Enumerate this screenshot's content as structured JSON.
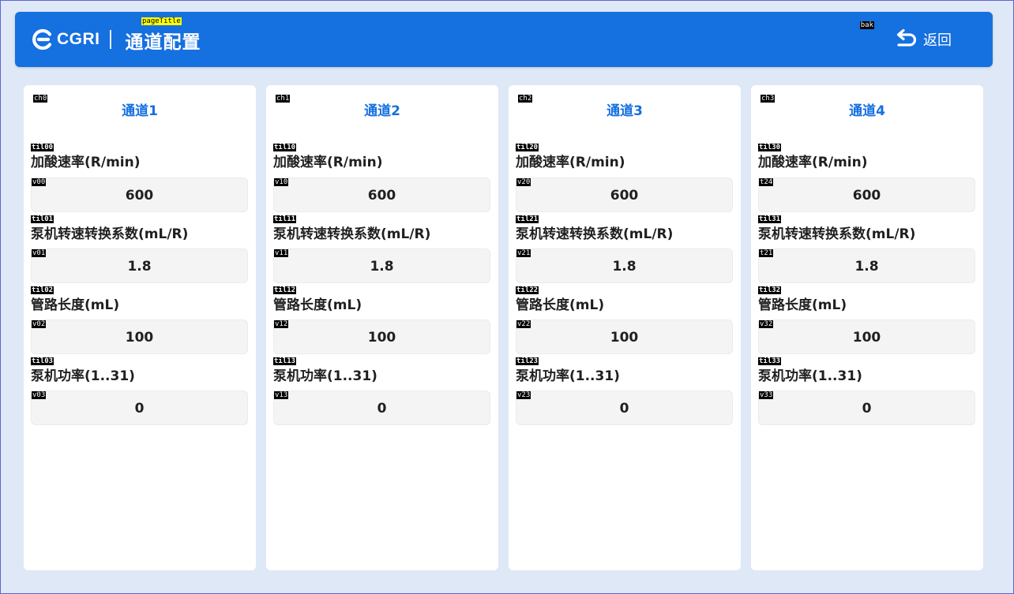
{
  "header": {
    "brand": "CGRI",
    "title": "通道配置",
    "title_tag": "pageTitle",
    "back_label": "返回",
    "back_tag": "bak"
  },
  "colors": {
    "header_bg": "#1570e0",
    "page_bg": "#dfe8f6",
    "channel_title": "#1570e0"
  },
  "icons": {
    "logo": "cgri-logo-icon",
    "back": "return-arrow-icon"
  },
  "channels": [
    {
      "title": "通道1",
      "tag": "ch0",
      "fields": [
        {
          "label": "加酸速率(R/min)",
          "label_tag": "til00",
          "value": "600",
          "value_tag": "v00"
        },
        {
          "label": "泵机转速转换系数(mL/R)",
          "label_tag": "til01",
          "value": "1.8",
          "value_tag": "v01"
        },
        {
          "label": "管路长度(mL)",
          "label_tag": "til02",
          "value": "100",
          "value_tag": "v02"
        },
        {
          "label": "泵机功率(1..31)",
          "label_tag": "til03",
          "value": "0",
          "value_tag": "v03"
        }
      ]
    },
    {
      "title": "通道2",
      "tag": "ch1",
      "fields": [
        {
          "label": "加酸速率(R/min)",
          "label_tag": "til10",
          "value": "600",
          "value_tag": "v10"
        },
        {
          "label": "泵机转速转换系数(mL/R)",
          "label_tag": "til11",
          "value": "1.8",
          "value_tag": "v11"
        },
        {
          "label": "管路长度(mL)",
          "label_tag": "til12",
          "value": "100",
          "value_tag": "v12"
        },
        {
          "label": "泵机功率(1..31)",
          "label_tag": "til13",
          "value": "0",
          "value_tag": "v13"
        }
      ]
    },
    {
      "title": "通道3",
      "tag": "ch2",
      "fields": [
        {
          "label": "加酸速率(R/min)",
          "label_tag": "til20",
          "value": "600",
          "value_tag": "v20"
        },
        {
          "label": "泵机转速转换系数(mL/R)",
          "label_tag": "til21",
          "value": "1.8",
          "value_tag": "v21"
        },
        {
          "label": "管路长度(mL)",
          "label_tag": "til22",
          "value": "100",
          "value_tag": "v22"
        },
        {
          "label": "泵机功率(1..31)",
          "label_tag": "til23",
          "value": "0",
          "value_tag": "v23"
        }
      ]
    },
    {
      "title": "通道4",
      "tag": "ch3",
      "fields": [
        {
          "label": "加酸速率(R/min)",
          "label_tag": "til30",
          "value": "600",
          "value_tag": "t24"
        },
        {
          "label": "泵机转速转换系数(mL/R)",
          "label_tag": "til31",
          "value": "1.8",
          "value_tag": "t21"
        },
        {
          "label": "管路长度(mL)",
          "label_tag": "til32",
          "value": "100",
          "value_tag": "v32"
        },
        {
          "label": "泵机功率(1..31)",
          "label_tag": "til33",
          "value": "0",
          "value_tag": "v33"
        }
      ]
    }
  ]
}
